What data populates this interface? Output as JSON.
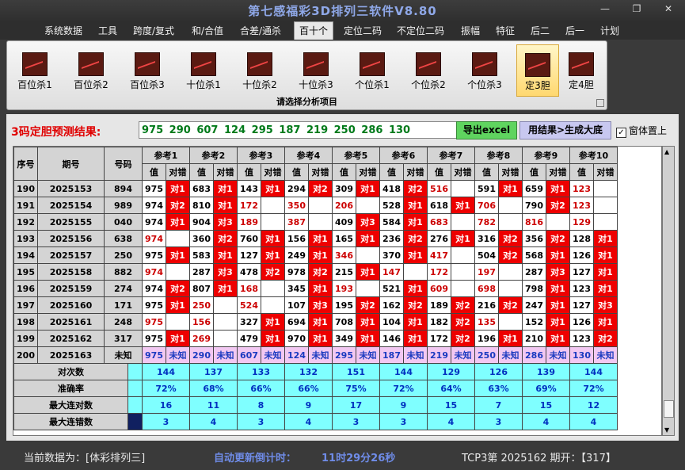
{
  "title": "第七感福彩3D排列三软件V8.80",
  "window_buttons": [
    "—",
    "❐",
    "✕"
  ],
  "menu": [
    "系统数据",
    "工具",
    "跨度/复式",
    "和/合值",
    "合差/通杀",
    "百十个",
    "定位二码",
    "不定位二码",
    "振幅",
    "特征",
    "后二",
    "后一",
    "计划"
  ],
  "ribbon": {
    "buttons": [
      "百位杀1",
      "百位杀2",
      "百位杀3",
      "十位杀1",
      "十位杀2",
      "十位杀3",
      "个位杀1",
      "个位杀2",
      "个位杀3",
      "定3胆",
      "定4胆"
    ],
    "caption": "请选择分析项目"
  },
  "prediction": {
    "label": "3码定胆预测结果:",
    "value": "975 290 607 124 295 187 219 250 286 130"
  },
  "buttons": {
    "excel": "导出excel",
    "generate": "用结果>生成大底",
    "ontop": "窗体置上",
    "ontop_checked": "✓"
  },
  "table": {
    "head": [
      "序号",
      "期号",
      "号码"
    ],
    "groups": [
      "参考1",
      "参考2",
      "参考3",
      "参考4",
      "参考5",
      "参考6",
      "参考7",
      "参考8",
      "参考9",
      "参考10"
    ],
    "sub": [
      "值",
      "对错"
    ],
    "rows": [
      {
        "seq": "190",
        "period": "2025153",
        "num": "894",
        "cells": [
          [
            "975",
            "对1"
          ],
          [
            "683",
            "对1"
          ],
          [
            "143",
            "对1"
          ],
          [
            "294",
            "对2"
          ],
          [
            "309",
            "对1"
          ],
          [
            "418",
            "对2"
          ],
          [
            "516",
            ""
          ],
          [
            "591",
            "对1"
          ],
          [
            "659",
            "对1"
          ],
          [
            "123",
            ""
          ]
        ]
      },
      {
        "seq": "191",
        "period": "2025154",
        "num": "989",
        "cells": [
          [
            "974",
            "对2"
          ],
          [
            "810",
            "对1"
          ],
          [
            "172",
            ""
          ],
          [
            "350",
            ""
          ],
          [
            "206",
            ""
          ],
          [
            "528",
            "对1"
          ],
          [
            "618",
            "对1"
          ],
          [
            "706",
            ""
          ],
          [
            "790",
            "对2"
          ],
          [
            "123",
            ""
          ]
        ]
      },
      {
        "seq": "192",
        "period": "2025155",
        "num": "040",
        "cells": [
          [
            "974",
            "对1"
          ],
          [
            "904",
            "对3"
          ],
          [
            "189",
            ""
          ],
          [
            "387",
            ""
          ],
          [
            "409",
            "对3"
          ],
          [
            "584",
            "对1"
          ],
          [
            "683",
            ""
          ],
          [
            "782",
            ""
          ],
          [
            "816",
            ""
          ],
          [
            "129",
            ""
          ]
        ]
      },
      {
        "seq": "193",
        "period": "2025156",
        "num": "638",
        "cells": [
          [
            "974",
            ""
          ],
          [
            "360",
            "对2"
          ],
          [
            "760",
            "对1"
          ],
          [
            "156",
            "对1"
          ],
          [
            "165",
            "对1"
          ],
          [
            "236",
            "对2"
          ],
          [
            "276",
            "对1"
          ],
          [
            "316",
            "对2"
          ],
          [
            "356",
            "对2"
          ],
          [
            "128",
            "对1"
          ]
        ]
      },
      {
        "seq": "194",
        "period": "2025157",
        "num": "250",
        "cells": [
          [
            "975",
            "对1"
          ],
          [
            "583",
            "对1"
          ],
          [
            "127",
            "对1"
          ],
          [
            "249",
            "对1"
          ],
          [
            "346",
            ""
          ],
          [
            "370",
            "对1"
          ],
          [
            "417",
            ""
          ],
          [
            "504",
            "对2"
          ],
          [
            "568",
            "对1"
          ],
          [
            "126",
            "对1"
          ]
        ]
      },
      {
        "seq": "195",
        "period": "2025158",
        "num": "882",
        "cells": [
          [
            "974",
            ""
          ],
          [
            "287",
            "对3"
          ],
          [
            "478",
            "对2"
          ],
          [
            "978",
            "对2"
          ],
          [
            "215",
            "对1"
          ],
          [
            "147",
            ""
          ],
          [
            "172",
            ""
          ],
          [
            "197",
            ""
          ],
          [
            "287",
            "对3"
          ],
          [
            "127",
            "对1"
          ]
        ]
      },
      {
        "seq": "196",
        "period": "2025159",
        "num": "274",
        "cells": [
          [
            "974",
            "对2"
          ],
          [
            "807",
            "对1"
          ],
          [
            "168",
            ""
          ],
          [
            "345",
            "对1"
          ],
          [
            "193",
            ""
          ],
          [
            "521",
            "对1"
          ],
          [
            "609",
            ""
          ],
          [
            "698",
            ""
          ],
          [
            "798",
            "对1"
          ],
          [
            "123",
            "对1"
          ]
        ]
      },
      {
        "seq": "197",
        "period": "2025160",
        "num": "171",
        "cells": [
          [
            "975",
            "对1"
          ],
          [
            "250",
            ""
          ],
          [
            "524",
            ""
          ],
          [
            "107",
            "对3"
          ],
          [
            "195",
            "对2"
          ],
          [
            "162",
            "对2"
          ],
          [
            "189",
            "对2"
          ],
          [
            "216",
            "对2"
          ],
          [
            "247",
            "对1"
          ],
          [
            "127",
            "对3"
          ]
        ]
      },
      {
        "seq": "198",
        "period": "2025161",
        "num": "248",
        "cells": [
          [
            "975",
            ""
          ],
          [
            "156",
            ""
          ],
          [
            "327",
            "对1"
          ],
          [
            "694",
            "对1"
          ],
          [
            "708",
            "对1"
          ],
          [
            "104",
            "对1"
          ],
          [
            "182",
            "对2"
          ],
          [
            "135",
            ""
          ],
          [
            "152",
            "对1"
          ],
          [
            "126",
            "对1"
          ]
        ]
      },
      {
        "seq": "199",
        "period": "2025162",
        "num": "317",
        "cells": [
          [
            "975",
            "对1"
          ],
          [
            "269",
            ""
          ],
          [
            "479",
            "对1"
          ],
          [
            "970",
            "对1"
          ],
          [
            "349",
            "对1"
          ],
          [
            "146",
            "对1"
          ],
          [
            "172",
            "对2"
          ],
          [
            "196",
            "对1"
          ],
          [
            "210",
            "对1"
          ],
          [
            "123",
            "对2"
          ]
        ]
      }
    ],
    "last": {
      "seq": "200",
      "period": "2025163",
      "num": "未知",
      "cells": [
        [
          "975",
          "未知"
        ],
        [
          "290",
          "未知"
        ],
        [
          "607",
          "未知"
        ],
        [
          "124",
          "未知"
        ],
        [
          "295",
          "未知"
        ],
        [
          "187",
          "未知"
        ],
        [
          "219",
          "未知"
        ],
        [
          "250",
          "未知"
        ],
        [
          "286",
          "未知"
        ],
        [
          "130",
          "未知"
        ]
      ]
    },
    "stats": [
      {
        "label": "对次数",
        "values": [
          "144",
          "137",
          "133",
          "132",
          "151",
          "144",
          "129",
          "126",
          "139",
          "144"
        ]
      },
      {
        "label": "准确率",
        "values": [
          "72%",
          "68%",
          "66%",
          "66%",
          "75%",
          "72%",
          "64%",
          "63%",
          "69%",
          "72%"
        ]
      },
      {
        "label": "最大连对数",
        "values": [
          "16",
          "11",
          "8",
          "9",
          "17",
          "9",
          "15",
          "7",
          "15",
          "12"
        ]
      },
      {
        "label": "最大连错数",
        "values": [
          "3",
          "4",
          "3",
          "4",
          "3",
          "3",
          "4",
          "3",
          "4",
          "4"
        ]
      }
    ]
  },
  "status": {
    "data_label": "当前数据为：[体彩排列三]",
    "countdown_label": "自动更新倒计时：",
    "countdown": "11时29分26秒",
    "draw_info": "TCP3第 2025162 期开：【317】"
  },
  "colors": {
    "hit": "#ee0000",
    "miss_text": "#cc0000",
    "stats_bg": "#7fffff",
    "stats_text": "#0030c0",
    "pending_bg": "#f2c8f2",
    "prediction_text": "#007a1a",
    "title_text": "#8fa8e8"
  }
}
